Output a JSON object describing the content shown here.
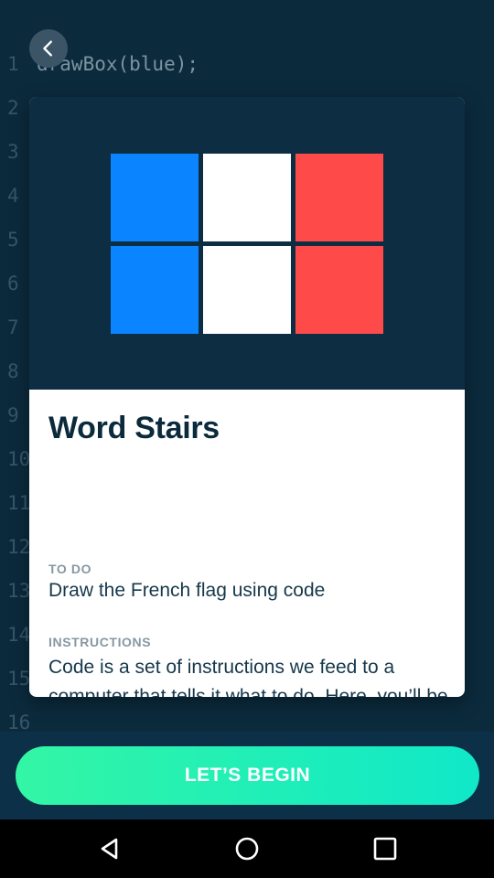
{
  "editor": {
    "lines": [
      {
        "num": "1",
        "code": "drawBox(blue);"
      },
      {
        "num": "2",
        "code": ""
      },
      {
        "num": "3",
        "code": ""
      },
      {
        "num": "4",
        "code": ""
      },
      {
        "num": "5",
        "code": ""
      },
      {
        "num": "6",
        "code": ""
      },
      {
        "num": "7",
        "code": ""
      },
      {
        "num": "8",
        "code": ""
      },
      {
        "num": "9",
        "code": ""
      },
      {
        "num": "10",
        "code": ""
      },
      {
        "num": "11",
        "code": ""
      },
      {
        "num": "12",
        "code": ""
      },
      {
        "num": "13",
        "code": ""
      },
      {
        "num": "14",
        "code": ""
      },
      {
        "num": "15",
        "code": ""
      },
      {
        "num": "16",
        "code": ""
      }
    ]
  },
  "back_button": {
    "icon": "chevron-left-icon"
  },
  "preview": {
    "flag_colors": [
      "#0a84ff",
      "#ffffff",
      "#ff4a4a"
    ],
    "rows": 2
  },
  "modal": {
    "title": "Word Stairs",
    "todo_label": "TO DO",
    "todo_text": "Draw the French flag using code",
    "instructions_label": "INSTRUCTIONS",
    "instructions_text": "Code is a set of instructions we feed to a computer that tells it what to do. Here, you’ll be doing just that: instructing your phone to draw the French Flag."
  },
  "action": {
    "begin_label": "LET’S BEGIN"
  },
  "navbar": {
    "icons": [
      "back-triangle-icon",
      "home-circle-icon",
      "recents-square-icon"
    ]
  }
}
